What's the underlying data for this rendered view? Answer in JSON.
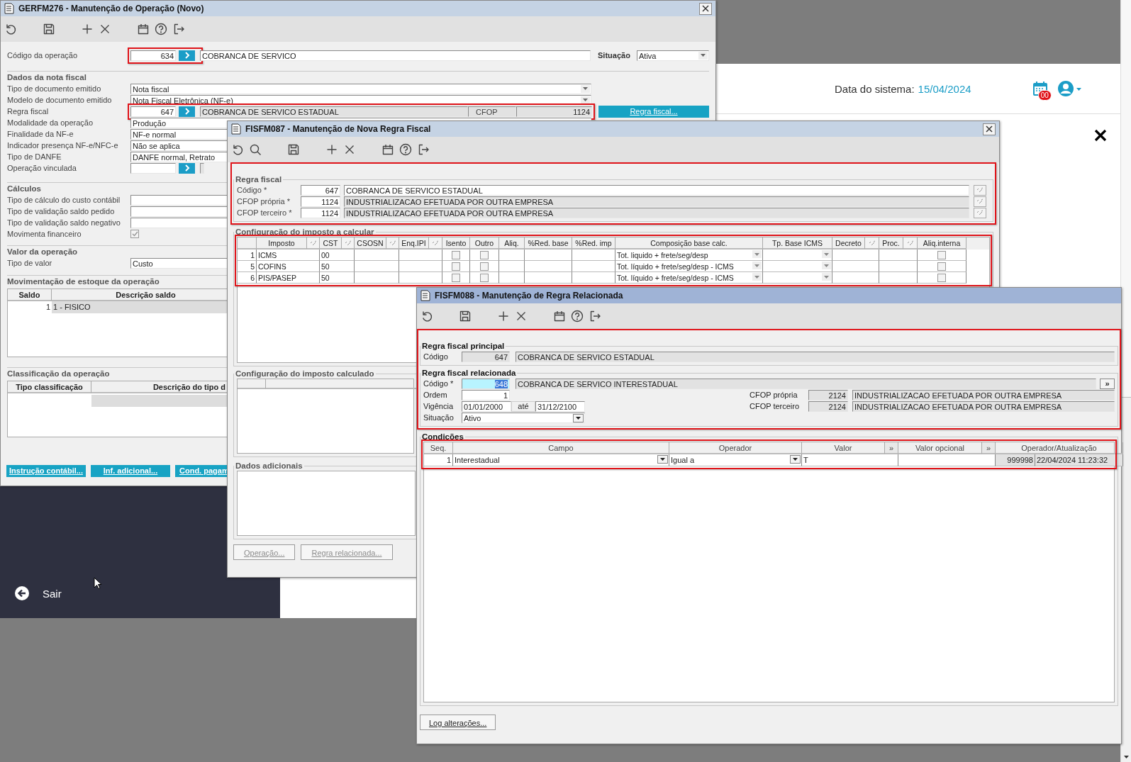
{
  "app_header": {
    "date_label": "Data do sistema:",
    "date": "15/04/2024",
    "badge": "00"
  },
  "sidebar": {
    "exit": "Sair"
  },
  "operation_window": {
    "title": "GERFM276 - Manutenção de Operação (Novo)",
    "active": false,
    "code_row": {
      "label": "Código da operação",
      "code": "634",
      "description": "COBRANCA DE SERVICO",
      "highlighted": true
    },
    "status": {
      "label": "Situação",
      "value": "Ativa"
    },
    "sections": [
      {
        "title": "Dados da nota fiscal",
        "rows": [
          {
            "kind": "select",
            "label": "Tipo de documento emitido",
            "value": "Nota fiscal"
          },
          {
            "kind": "select",
            "label": "Modelo de documento emitido",
            "value": "Nota Fiscal Eletrônica (NF-e)"
          },
          {
            "kind": "rule",
            "label": "Regra fiscal",
            "code": "647",
            "description": "COBRANCA DE SERVICO ESTADUAL",
            "cfop_label": "CFOP",
            "cfop": "1124",
            "button": "Regra fiscal...",
            "highlighted": true
          },
          {
            "kind": "text",
            "label": "Modalidade da operação",
            "value": "Produção"
          },
          {
            "kind": "text",
            "label": "Finalidade da NF-e",
            "value": "NF-e normal"
          },
          {
            "kind": "text",
            "label": "Indicador presença NF-e/NFC-e",
            "value": "Não se aplica"
          },
          {
            "kind": "text",
            "label": "Tipo de DANFE",
            "value": "DANFE normal, Retrato"
          },
          {
            "kind": "lookup",
            "label": "Operação vinculada"
          }
        ]
      },
      {
        "title": "Cálculos",
        "rows": [
          {
            "kind": "text",
            "label": "Tipo de cálculo do custo contábil"
          },
          {
            "kind": "text",
            "label": "Tipo de validação saldo pedido"
          },
          {
            "kind": "text",
            "label": "Tipo de validação saldo negativo"
          },
          {
            "kind": "checkbox",
            "label": "Movimenta financeiro",
            "checked": true
          }
        ]
      },
      {
        "title": "Valor da operação",
        "rows": [
          {
            "kind": "text",
            "label": "Tipo de valor",
            "value": "Custo"
          }
        ]
      }
    ],
    "stock_section": {
      "title": "Movimentação de estoque da operação",
      "columns": [
        "Saldo",
        "Descrição saldo"
      ],
      "rows": [
        {
          "balance": "1",
          "description": "1 - FISICO"
        }
      ]
    },
    "class_section": {
      "title": "Classificação da operação",
      "columns": [
        "Tipo classificação",
        "Descrição do tipo d"
      ]
    },
    "buttons": [
      "Instrução contábil...",
      "Inf. adicional...",
      "Cond. pagam"
    ]
  },
  "rule_window": {
    "title": "FISFM087 - Manutenção de Nova Regra Fiscal",
    "active": false,
    "rule_section": {
      "title": "Regra fiscal",
      "highlighted": true,
      "rows": [
        {
          "label": "Código *",
          "code": "647",
          "description": "COBRANCA DE SERVICO ESTADUAL",
          "disabled": false
        },
        {
          "label": "CFOP própria *",
          "code": "1124",
          "description": "INDUSTRIALIZACAO EFETUADA POR OUTRA EMPRESA",
          "disabled": true
        },
        {
          "label": "CFOP terceiro *",
          "code": "1124",
          "description": "INDUSTRIALIZACAO EFETUADA POR OUTRA EMPRESA",
          "disabled": true
        }
      ]
    },
    "tax_section": {
      "title": "Configuração do imposto a calcular",
      "highlighted": true,
      "columns": [
        {
          "kind": "text",
          "label": "Imposto"
        },
        {
          "kind": "lookup"
        },
        {
          "kind": "text",
          "label": "CST"
        },
        {
          "kind": "lookup"
        },
        {
          "kind": "text",
          "label": "CSOSN"
        },
        {
          "kind": "lookup"
        },
        {
          "kind": "text",
          "label": "Enq.IPI"
        },
        {
          "kind": "lookup"
        },
        {
          "kind": "text",
          "label": "Isento"
        },
        {
          "kind": "text",
          "label": "Outro"
        },
        {
          "kind": "text",
          "label": "Aliq."
        },
        {
          "kind": "text",
          "label": "%Red. base"
        },
        {
          "kind": "text",
          "label": "%Red. imp"
        },
        {
          "kind": "text",
          "label": "Composição base calc."
        },
        {
          "kind": "text",
          "label": "Tp. Base ICMS"
        },
        {
          "kind": "text",
          "label": "Decreto"
        },
        {
          "kind": "lookup"
        },
        {
          "kind": "text",
          "label": "Proc."
        },
        {
          "kind": "lookup"
        },
        {
          "kind": "text",
          "label": "Aliq.interna"
        }
      ],
      "rows": [
        {
          "seq": "1",
          "tax": "ICMS",
          "cst": "00",
          "exempt": false,
          "other": false,
          "composition": "Tot. liquido + frete/seg/desp",
          "internal_rate": false
        },
        {
          "seq": "5",
          "tax": "COFINS",
          "cst": "50",
          "exempt": false,
          "other": false,
          "composition": "Tot. líquido + frete/seg/desp - ICMS",
          "internal_rate": false
        },
        {
          "seq": "6",
          "tax": "PIS/PASEP",
          "cst": "50",
          "exempt": false,
          "other": false,
          "composition": "Tot. líquido + frete/seg/desp - ICMS",
          "internal_rate": false
        }
      ]
    },
    "calculated_section": {
      "title": "Configuração do imposto calculado"
    },
    "notes_section": {
      "title": "Dados adicionais"
    },
    "buttons": [
      {
        "label": "Operação...",
        "disabled": true
      },
      {
        "label": "Regra relacionada...",
        "disabled": true
      }
    ]
  },
  "related_window": {
    "title": "FISFM088 - Manutenção de Regra Relacionada",
    "active": true,
    "highlighted": true,
    "main_rule": {
      "title": "Regra fiscal principal",
      "label": "Código",
      "code": "647",
      "description": "COBRANCA DE SERVICO ESTADUAL"
    },
    "related_rule": {
      "title": "Regra fiscal relacionada",
      "code_label": "Código *",
      "code": "648",
      "code_selected": true,
      "description": "COBRANCA DE SERVICO INTERESTADUAL",
      "more": "»",
      "order_label": "Ordem",
      "order": "1",
      "validity_label": "Vigência",
      "valid_from": "01/01/2000",
      "until_label": "até",
      "valid_to": "31/12/2100",
      "status_label": "Situação",
      "status": "Ativo",
      "cfops": [
        {
          "label": "CFOP própria",
          "code": "2124",
          "description": "INDUSTRIALIZACAO EFETUADA POR OUTRA EMPRESA"
        },
        {
          "label": "CFOP terceiro",
          "code": "2124",
          "description": "INDUSTRIALIZACAO EFETUADA POR OUTRA EMPRESA"
        }
      ]
    },
    "conditions": {
      "title": "Condições",
      "highlighted": true,
      "columns": [
        {
          "kind": "text",
          "label": "Seq."
        },
        {
          "kind": "text",
          "label": "Campo"
        },
        {
          "kind": "text",
          "label": "Operador"
        },
        {
          "kind": "text",
          "label": "Valor"
        },
        {
          "kind": "more",
          "label": "»"
        },
        {
          "kind": "text",
          "label": "Valor opcional"
        },
        {
          "kind": "more",
          "label": "»"
        },
        {
          "kind": "text",
          "label": "Operador/Atualização"
        }
      ],
      "rows": [
        {
          "seq": "1",
          "field": "Interestadual",
          "operator": "Igual a",
          "value": "T",
          "user": "999998",
          "updated": "22/04/2024 11:23:32"
        }
      ]
    },
    "log_button": "Log alterações..."
  }
}
